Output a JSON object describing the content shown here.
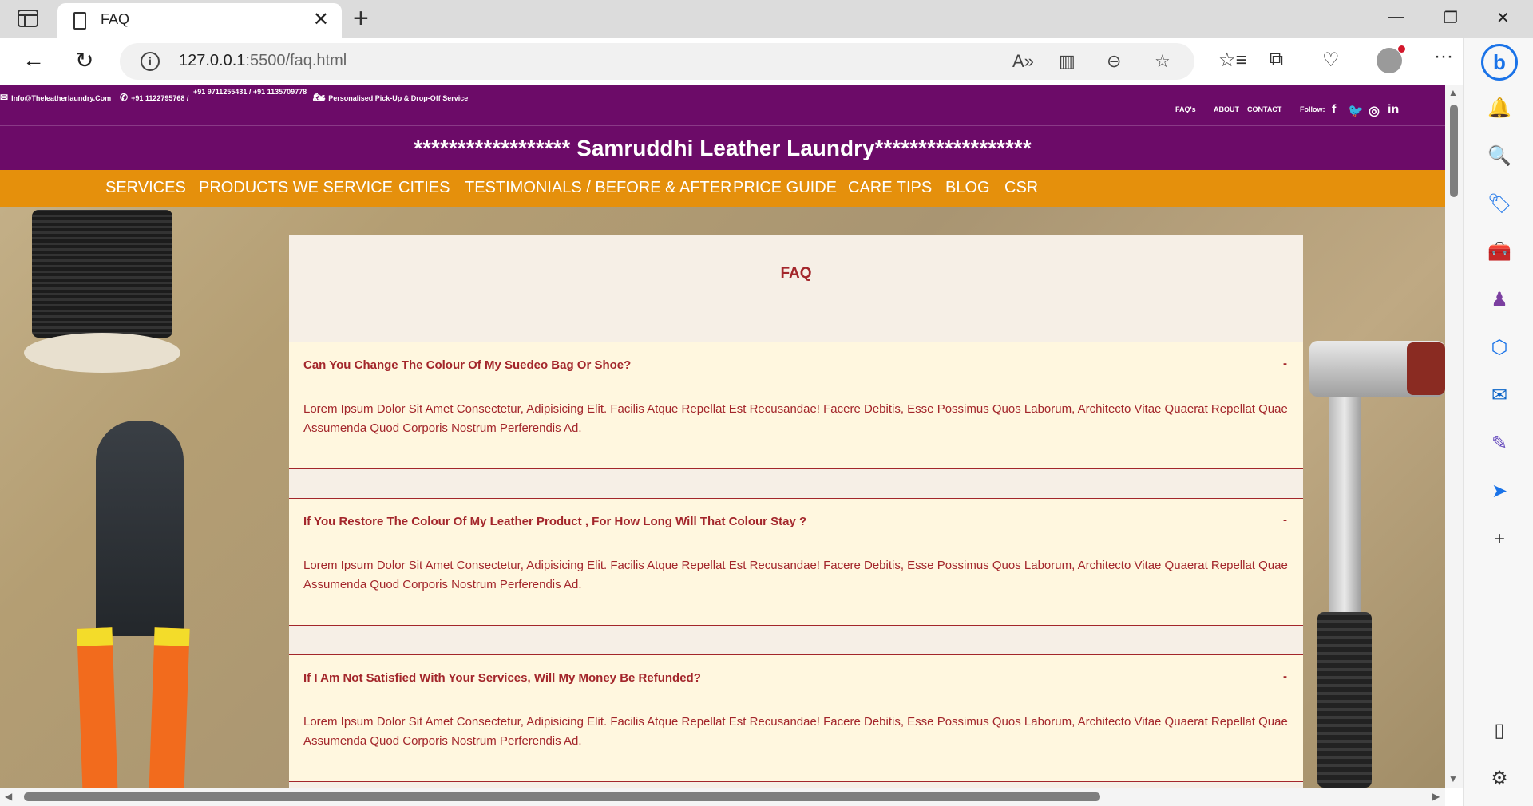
{
  "browser": {
    "tab_title": "FAQ",
    "url_host": "127.0.0.1",
    "url_rest": ":5500/faq.html"
  },
  "site": {
    "contact_email": "Info@Theleatherlaundry.Com",
    "phone_1": "+91 1122795768 /",
    "phone_2": "+91 9711255431 / +91 1135709778",
    "pickup_note": "Personalised Pick-Up & Drop-Off Service",
    "header_links": [
      "FAQ's",
      "ABOUT",
      "CONTACT"
    ],
    "follow_label": "Follow:",
    "social": [
      "f",
      "t",
      "ig",
      "in"
    ],
    "title": "****************** Samruddhi Leather Laundry******************",
    "nav": [
      "SERVICES",
      "PRODUCTS WE SERVICE",
      "CITIES",
      "TESTIMONIALS / BEFORE & AFTER",
      "PRICE GUIDE",
      "CARE TIPS",
      "BLOG",
      "CSR"
    ]
  },
  "faq": {
    "heading": "FAQ",
    "toggle_symbol": "-",
    "items": [
      {
        "question": "Can You Change The Colour Of My Suedeo Bag Or Shoe?",
        "answer": "Lorem Ipsum Dolor Sit Amet Consectetur, Adipisicing Elit. Facilis Atque Repellat Est Recusandae! Facere Debitis, Esse Possimus Quos Laborum, Architecto Vitae Quaerat Repellat Quae Assumenda Quod Corporis Nostrum Perferendis Ad."
      },
      {
        "question": "If You Restore The Colour Of My Leather Product , For How Long Will That Colour Stay ?",
        "answer": "Lorem Ipsum Dolor Sit Amet Consectetur, Adipisicing Elit. Facilis Atque Repellat Est Recusandae! Facere Debitis, Esse Possimus Quos Laborum, Architecto Vitae Quaerat Repellat Quae Assumenda Quod Corporis Nostrum Perferendis Ad."
      },
      {
        "question": "If I Am Not Satisfied With Your Services, Will My Money Be Refunded?",
        "answer": "Lorem Ipsum Dolor Sit Amet Consectetur, Adipisicing Elit. Facilis Atque Repellat Est Recusandae! Facere Debitis, Esse Possimus Quos Laborum, Architecto Vitae Quaerat Repellat Quae Assumenda Quod Corporis Nostrum Perferendis Ad."
      }
    ]
  },
  "colors": {
    "brand_purple": "#6c0b68",
    "nav_orange": "#e5900c",
    "faq_text": "#a3262b"
  }
}
